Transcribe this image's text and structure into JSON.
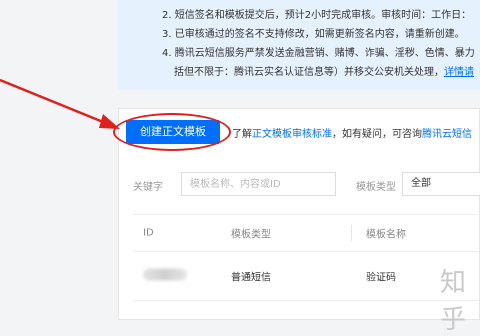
{
  "notice": {
    "items": [
      {
        "text": "2. 短信签名和模板提交后，预计2小时完成审核。审核时间：工作日："
      },
      {
        "text": "3. 已审核通过的签名不支持修改，如需更新签名内容，请重新创建。"
      },
      {
        "text": "4. 腾讯云短信服务严禁发送金融营销、赌博、诈骗、淫秽、色情、暴力"
      },
      {
        "text": "括但不限于：腾讯云实名认证信息等）并移交公安机关处理，",
        "link": "详情请"
      }
    ]
  },
  "create_button": {
    "label": "创建正文模板"
  },
  "help": {
    "prefix": "了解",
    "link1": "正文模板审核标准",
    "middle": "，如有疑问，可咨询",
    "link2": "腾讯云短信"
  },
  "filters": {
    "keyword_label": "关键字",
    "keyword_placeholder": "模板名称、内容或ID",
    "type_label": "模板类型",
    "type_value": "全部"
  },
  "table": {
    "columns": [
      "ID",
      "模板类型",
      "模板名称"
    ],
    "rows": [
      {
        "id": "",
        "type": "普通短信",
        "name": "验证码"
      }
    ]
  },
  "watermark": "知乎",
  "colors": {
    "accent": "#006eff",
    "annotation": "#e0201a"
  }
}
